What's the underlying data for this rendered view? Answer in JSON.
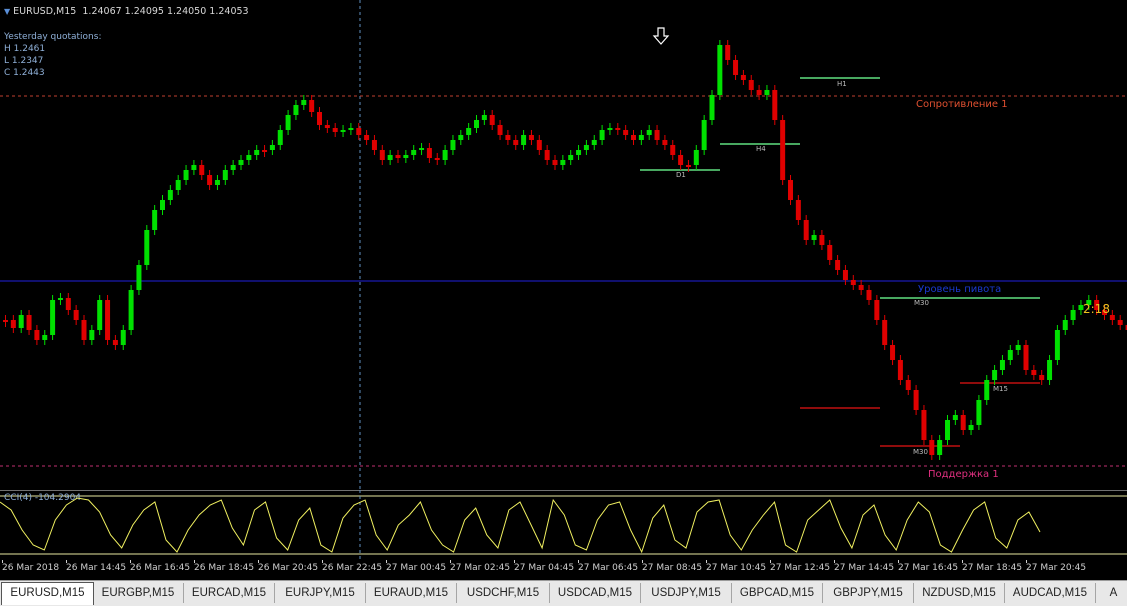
{
  "header": {
    "symbol": "EURUSD,M15",
    "ohlc": "1.24067 1.24095 1.24050 1.24053"
  },
  "yesterday": {
    "title": "Yesterday quotations:",
    "high": "H 1.2461",
    "low": "L 1.2347",
    "close": "C 1.2443"
  },
  "levels": {
    "resistance_label": "Сопротивление 1",
    "support_label": "Поддержка 1",
    "price_level_label": "Уровень пивота",
    "h1": "H1",
    "h4": "H4",
    "d1": "D1",
    "m30_top": "M30",
    "m15": "M15",
    "m30_bottom": "M30"
  },
  "timer": "2:18",
  "indicator": {
    "label": "CCI(4) -104.2904"
  },
  "time_axis": [
    "26 Mar 2018",
    "26 Mar 14:45",
    "26 Mar 16:45",
    "26 Mar 18:45",
    "26 Mar 20:45",
    "26 Mar 22:45",
    "27 Mar 00:45",
    "27 Mar 02:45",
    "27 Mar 04:45",
    "27 Mar 06:45",
    "27 Mar 08:45",
    "27 Mar 10:45",
    "27 Mar 12:45",
    "27 Mar 14:45",
    "27 Mar 16:45",
    "27 Mar 18:45",
    "27 Mar 20:45"
  ],
  "tabs": [
    "EURUSD,M15",
    "EURGBP,M15",
    "EURCAD,M15",
    "EURJPY,M15",
    "EURAUD,M15",
    "USDCHF,M15",
    "USDCAD,M15",
    "USDJPY,M15",
    "GBPCAD,M15",
    "GBPJPY,M15",
    "NZDUSD,M15",
    "AUDCAD,M15",
    "A"
  ],
  "active_tab": "EURUSD,M15",
  "colors": {
    "bull": "#00e000",
    "bear": "#e00000",
    "resistance": "#e05030",
    "support": "#e03080",
    "pivot_line": "#1a1aa0",
    "cci_line": "#f0f060",
    "level_green": "#60e080",
    "level_red": "#c01010"
  }
}
